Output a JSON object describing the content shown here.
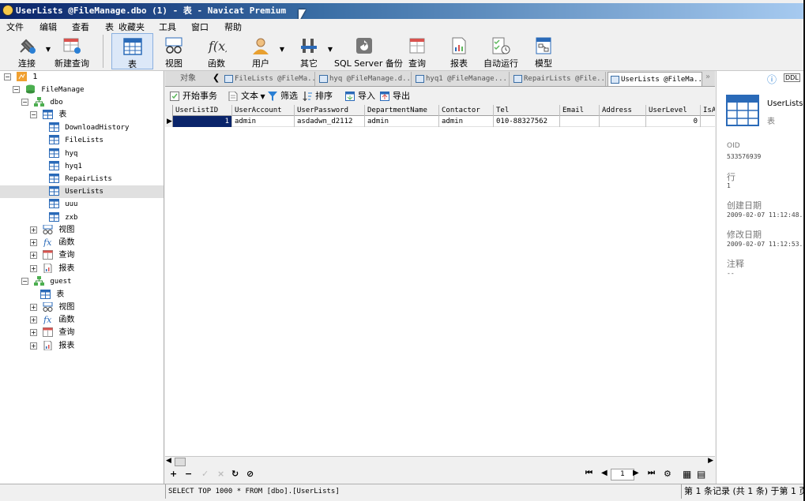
{
  "window": {
    "title": "UserLists @FileManage.dbo (1) - 表 - Navicat Premium"
  },
  "menu": [
    "文件",
    "编辑",
    "查看",
    "表",
    "收藏夹",
    "工具",
    "窗口",
    "帮助"
  ],
  "toolbar": {
    "connect": "连接",
    "new_query": "新建查询",
    "table": "表",
    "view": "视图",
    "function": "函数",
    "user": "用户",
    "other": "其它",
    "backup": "SQL Server 备份",
    "query": "查询",
    "report": "报表",
    "automation": "自动运行",
    "model": "模型"
  },
  "tree": {
    "connection": "1",
    "database": "FileManage",
    "schema_dbo": "dbo",
    "tables_label": "表",
    "tables": [
      "DownloadHistory",
      "FileLists",
      "hyq",
      "hyq1",
      "RepairLists",
      "UserLists",
      "uuu",
      "zxb"
    ],
    "views": "视图",
    "functions": "函数",
    "queries": "查询",
    "reports": "报表",
    "schema_guest": "guest",
    "guest_tables": "表",
    "guest_views": "视图",
    "guest_functions": "函数",
    "guest_queries": "查询",
    "guest_reports": "报表"
  },
  "object_tabs": {
    "objects_label": "对象",
    "tabs": [
      "FileLists @FileMa...",
      "hyq @FileManage.d...",
      "hyq1 @FileManage....",
      "RepairLists @File...",
      "UserLists @FileMa..."
    ]
  },
  "data_toolbar": {
    "begin_tx": "开始事务",
    "text": "文本",
    "filter": "筛选",
    "sort": "排序",
    "import": "导入",
    "export": "导出"
  },
  "grid": {
    "columns": [
      "UserListID",
      "UserAccount",
      "UserPassword",
      "DepartmentName",
      "Contactor",
      "Tel",
      "Email",
      "Address",
      "UserLevel",
      "IsA"
    ],
    "rows": [
      [
        "1",
        "admin",
        "asdadwn_d2112",
        "admin",
        "admin",
        "010-88327562",
        "",
        "",
        "0",
        ""
      ]
    ]
  },
  "navbar": {
    "page": "1"
  },
  "info_panel": {
    "name": "UserLists",
    "type": "表",
    "oid_label": "OID",
    "oid": "533576939",
    "rows_label": "行",
    "rows": "1",
    "created_label": "创建日期",
    "created": "2009-02-07 11:12:48.",
    "modified_label": "修改日期",
    "modified": "2009-02-07 11:12:53.",
    "comment_label": "注释",
    "comment": "--"
  },
  "status": {
    "sql": "SELECT TOP 1000 * FROM [dbo].[UserLists]",
    "record": "第 1 条记录 (共 1 条) 于第 1 页"
  }
}
